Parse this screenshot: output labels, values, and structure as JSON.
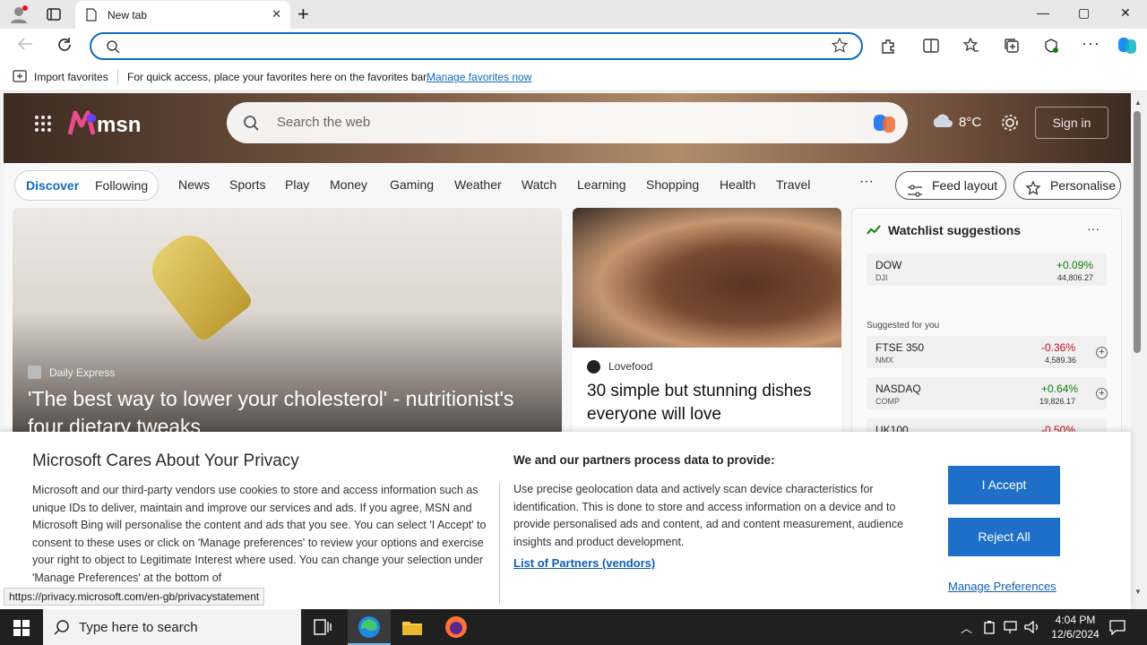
{
  "browser": {
    "tab_title": "New tab",
    "tab_close": "✕",
    "new_tab": "+",
    "address_value": "",
    "window_controls": {
      "minimize": "—",
      "maximize": "▢",
      "close": "✕"
    },
    "favbar": {
      "import_label": "Import favorites",
      "message": "For quick access, place your favorites here on the favorites bar.",
      "manage_link": "Manage favorites now"
    }
  },
  "msn": {
    "logo_text": "msn",
    "search_placeholder": "Search the web",
    "temperature": "8°C",
    "sign_in": "Sign in",
    "tabs": {
      "discover": "Discover",
      "following": "Following"
    },
    "nav": [
      "News",
      "Sports",
      "Play",
      "Money",
      "Gaming",
      "Weather",
      "Watch",
      "Learning",
      "Shopping",
      "Health",
      "Travel"
    ],
    "more": "···",
    "feed_layout": "Feed layout",
    "personalise": "Personalise",
    "card1": {
      "source": "Daily Express",
      "headline": "'The best way to lower your cholesterol' - nutritionist's four dietary tweaks"
    },
    "card2": {
      "source": "Lovefood",
      "headline": "30 simple but stunning dishes everyone will love"
    },
    "watchlist": {
      "title": "Watchlist suggestions",
      "more": "···",
      "suggested_label": "Suggested for you",
      "rows": [
        {
          "symbol": "DOW",
          "sub": "DJI",
          "change": "+0.09%",
          "value": "44,806.27",
          "dir": "pos"
        },
        {
          "symbol": "FTSE 350",
          "sub": "NMX",
          "change": "-0.36%",
          "value": "4,589.36",
          "dir": "neg"
        },
        {
          "symbol": "NASDAQ",
          "sub": "COMP",
          "change": "+0.64%",
          "value": "19,826.17",
          "dir": "pos"
        },
        {
          "symbol": "UK100",
          "sub": "",
          "change": "-0.50%",
          "value": "",
          "dir": "neg"
        }
      ]
    }
  },
  "privacy": {
    "title": "Microsoft Cares About Your Privacy",
    "body": "Microsoft and our third-party vendors use cookies to store and access information such as unique IDs to deliver, maintain and improve our services and ads. If you agree, MSN and Microsoft Bing will personalise the content and ads that you see. You can select 'I Accept' to consent to these uses or click on 'Manage preferences' to review your options and exercise your right to object to Legitimate Interest where used.  You can change your selection under 'Manage Preferences' at the bottom of",
    "heading2": "We and our partners process data to provide:",
    "body2": "Use precise geolocation data and actively scan device characteristics for identification. This is done to store and access information on a device and to provide personalised ads and content, ad and content measurement, audience insights and product development.",
    "partners_link": "List of Partners (vendors)",
    "accept": "I Accept",
    "reject": "Reject All",
    "manage": "Manage Preferences"
  },
  "status_url": "https://privacy.microsoft.com/en-gb/privacystatement",
  "taskbar": {
    "search_placeholder": "Type here to search",
    "time": "4:04 PM",
    "date": "12/6/2024"
  },
  "colors": {
    "accent": "#0f6cbd",
    "button": "#1d6fc7",
    "positive": "#107c10",
    "negative": "#c50f1f"
  }
}
